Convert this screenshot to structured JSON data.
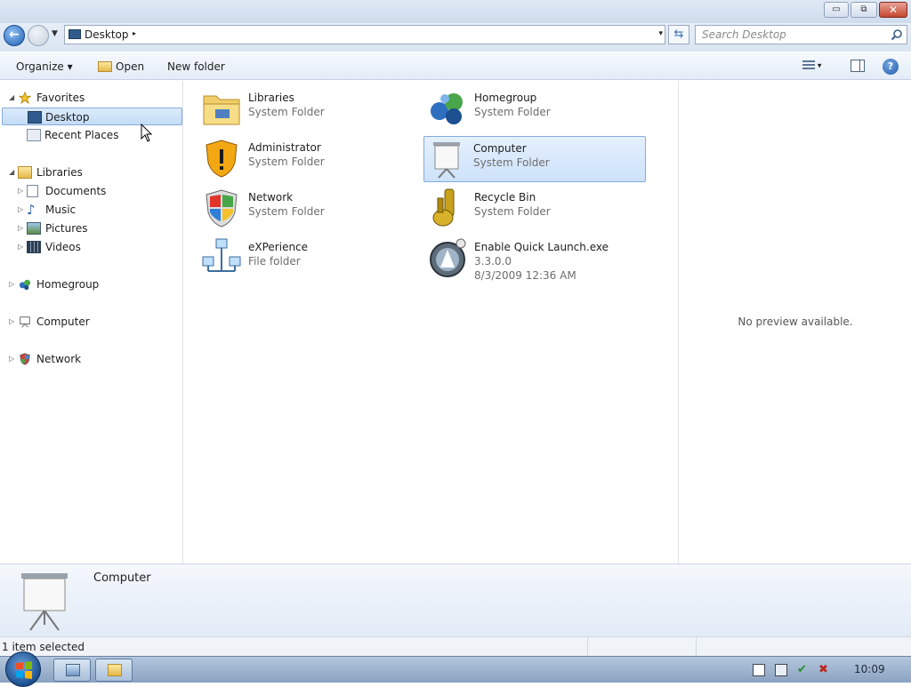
{
  "window": {
    "min_symbol": "▭",
    "max_symbol": "⧉",
    "close_symbol": "✕"
  },
  "address": {
    "path": "Desktop",
    "separator": "▸",
    "dropdown": "▾"
  },
  "search": {
    "placeholder": "Search Desktop"
  },
  "toolbar": {
    "organize": "Organize ▾",
    "open": "Open",
    "new_folder": "New folder",
    "view_arrow": "▾",
    "help": "?"
  },
  "nav": {
    "favorites": "Favorites",
    "desktop": "Desktop",
    "recent_places": "Recent Places",
    "libraries": "Libraries",
    "documents": "Documents",
    "music": "Music",
    "pictures": "Pictures",
    "videos": "Videos",
    "homegroup": "Homegroup",
    "computer": "Computer",
    "network": "Network"
  },
  "items": [
    {
      "name": "Libraries",
      "type": "System Folder"
    },
    {
      "name": "Homegroup",
      "type": "System Folder"
    },
    {
      "name": "Administrator",
      "type": "System Folder"
    },
    {
      "name": "Computer",
      "type": "System Folder"
    },
    {
      "name": "Network",
      "type": "System Folder"
    },
    {
      "name": "Recycle Bin",
      "type": "System Folder"
    },
    {
      "name": "eXPerience",
      "type": "File folder"
    },
    {
      "name": "Enable Quick Launch.exe",
      "type": "3.3.0.0",
      "date": "8/3/2009 12:36 AM"
    }
  ],
  "preview": {
    "message": "No preview available."
  },
  "details": {
    "name": "Computer"
  },
  "status": {
    "text": "1 item selected"
  },
  "taskbar": {
    "clock": "10:09"
  },
  "colors": {
    "selection": "#cde2fa",
    "selection_border": "#84acdd",
    "taskbar": "#8aa3c2"
  }
}
